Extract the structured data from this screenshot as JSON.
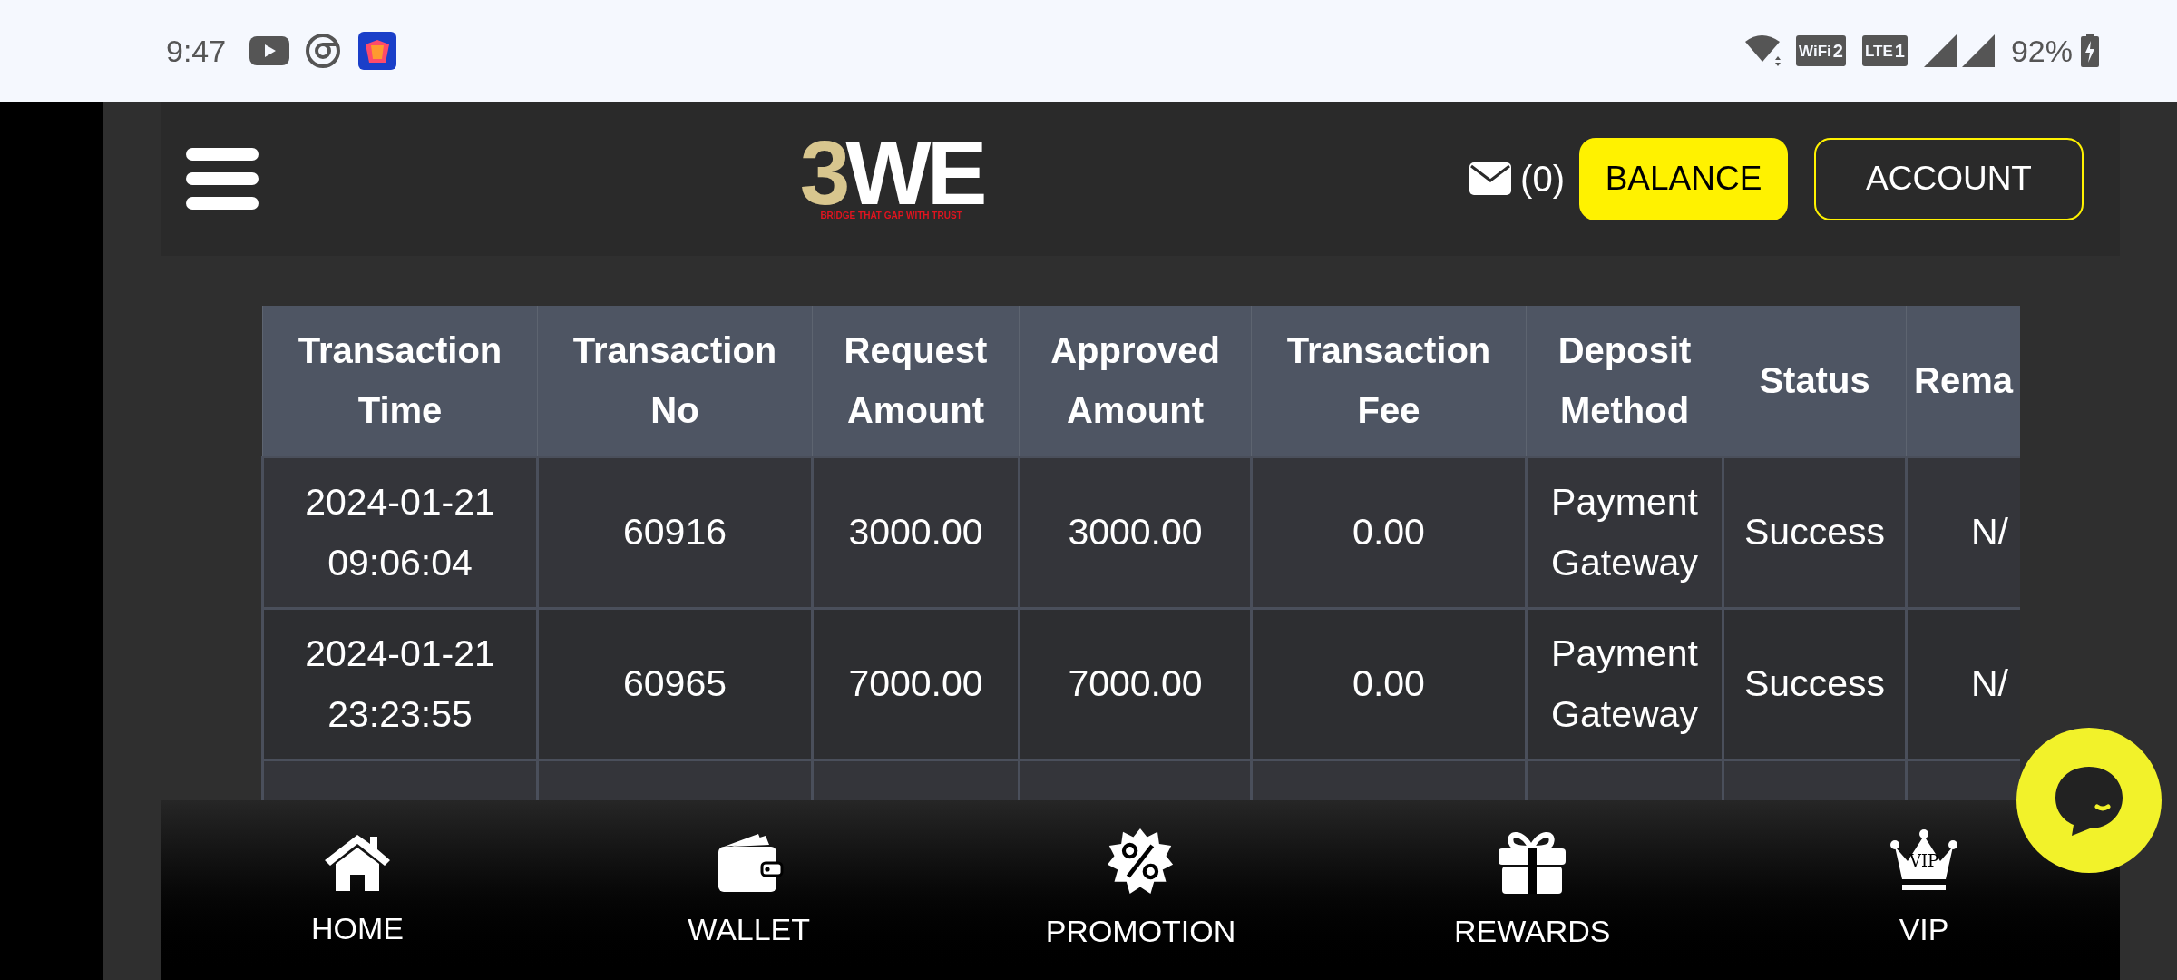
{
  "status_bar": {
    "time": "9:47",
    "wifi_label": "WiFi",
    "wifi_index": "2",
    "lte_label": "LTE",
    "lte_index": "1",
    "battery": "92%"
  },
  "header": {
    "logo_number": "3",
    "logo_letters": "WE",
    "tagline": "BRIDGE THAT GAP WITH TRUST",
    "mail_count": "(0)",
    "balance_button": "BALANCE",
    "account_button": "ACCOUNT"
  },
  "table": {
    "columns": [
      "Transaction Time",
      "Transaction No",
      "Request Amount",
      "Approved Amount",
      "Transaction Fee",
      "Deposit Method",
      "Status",
      "Rema"
    ],
    "rows": [
      [
        "2024-01-21 09:06:04",
        "60916",
        "3000.00",
        "3000.00",
        "0.00",
        "Payment Gateway",
        "Success",
        "N/"
      ],
      [
        "2024-01-21 23:23:55",
        "60965",
        "7000.00",
        "7000.00",
        "0.00",
        "Payment Gateway",
        "Success",
        "N/"
      ]
    ]
  },
  "bottom_nav": [
    {
      "label": "HOME",
      "kind": "home"
    },
    {
      "label": "WALLET",
      "kind": "wallet"
    },
    {
      "label": "PROMOTION",
      "kind": "promotion"
    },
    {
      "label": "REWARDS",
      "kind": "rewards"
    },
    {
      "label": "VIP",
      "kind": "vip",
      "icon_text": "VIP"
    }
  ]
}
